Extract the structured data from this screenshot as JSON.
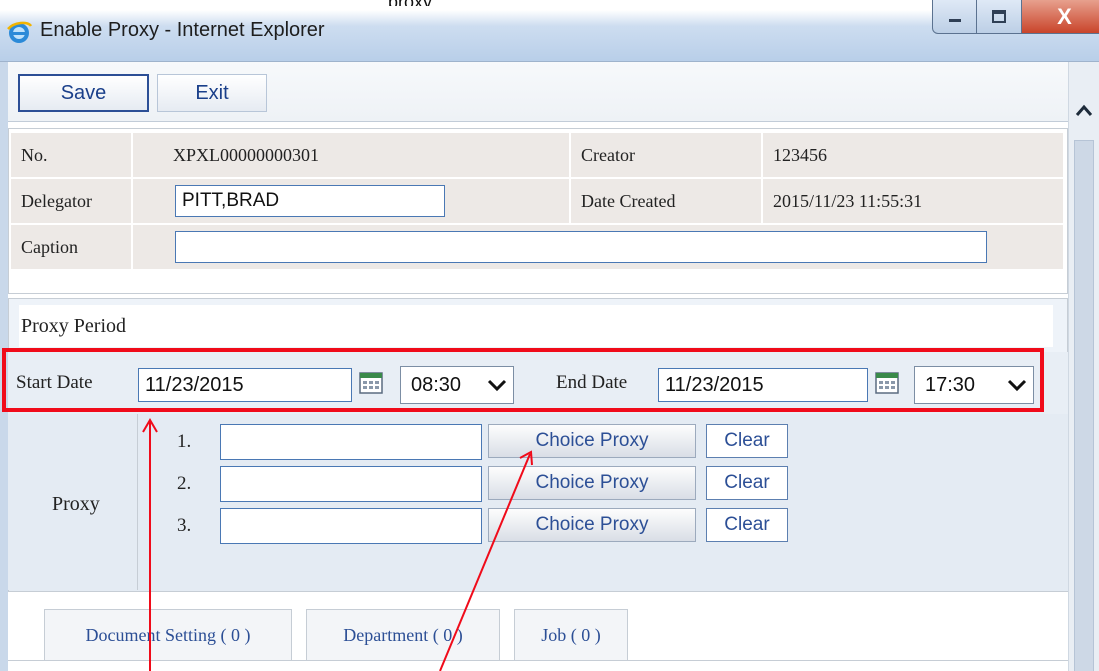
{
  "window": {
    "title": "Enable Proxy - Internet Explorer",
    "title_fragment": "proxy",
    "app_icon": "ie-icon",
    "controls": [
      "minimize-icon",
      "maximize-icon",
      "close-icon"
    ],
    "close_glyph": "X"
  },
  "toolbar": {
    "save_label": "Save",
    "exit_label": "Exit"
  },
  "form": {
    "no_label": "No.",
    "no_value": "XPXL00000000301",
    "creator_label": "Creator",
    "creator_value": "123456",
    "delegator_label": "Delegator",
    "delegator_value": "PITT,BRAD",
    "date_created_label": "Date Created",
    "date_created_value": "2015/11/23 11:55:31",
    "caption_label": "Caption",
    "caption_value": ""
  },
  "proxy_period": {
    "title": "Proxy Period",
    "start_label": "Start Date",
    "start_date": "11/23/2015",
    "start_time": "08:30",
    "end_label": "End Date",
    "end_date": "11/23/2015",
    "end_time": "17:30"
  },
  "proxy": {
    "label": "Proxy",
    "rows": [
      {
        "num": "1.",
        "value": "",
        "choice_label": "Choice Proxy",
        "clear_label": "Clear"
      },
      {
        "num": "2.",
        "value": "",
        "choice_label": "Choice Proxy",
        "clear_label": "Clear"
      },
      {
        "num": "3.",
        "value": "",
        "choice_label": "Choice Proxy",
        "clear_label": "Clear"
      }
    ]
  },
  "tabs": [
    {
      "label": "Document Setting ( 0 )"
    },
    {
      "label": "Department ( 0 )"
    },
    {
      "label": "Job ( 0 )"
    }
  ],
  "colors": {
    "annotation_red": "#f00b1a",
    "link_blue": "#2c4f96",
    "field_border": "#4a78b4",
    "label_bg": "#ede9e6"
  }
}
